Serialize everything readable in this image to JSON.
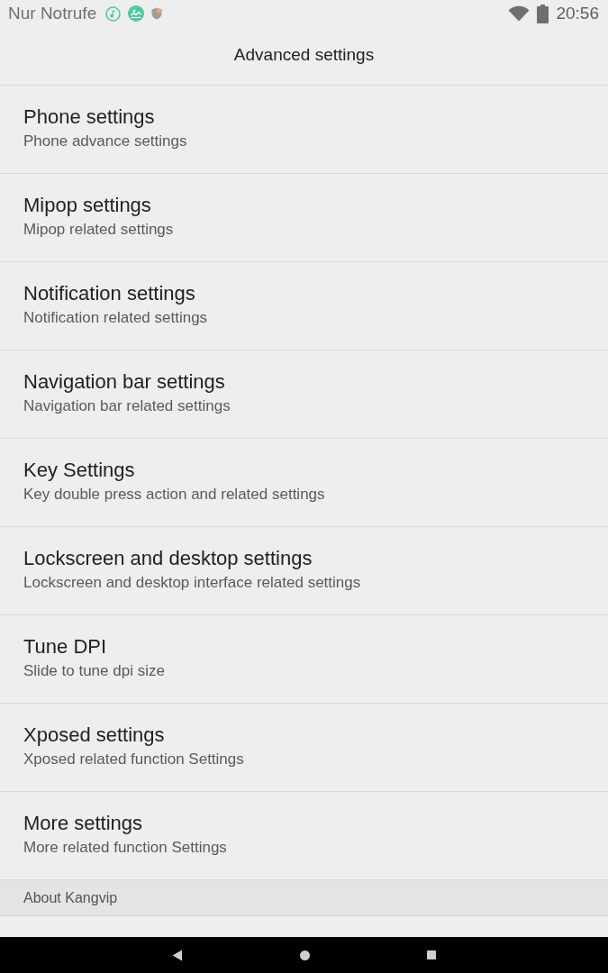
{
  "status_bar": {
    "carrier": "Nur Notrufe",
    "time": "20:56"
  },
  "toolbar": {
    "title": "Advanced settings"
  },
  "items": [
    {
      "title": "Phone settings",
      "summary": "Phone advance settings"
    },
    {
      "title": "Mipop settings",
      "summary": "Mipop related settings"
    },
    {
      "title": "Notification settings",
      "summary": "Notification related settings"
    },
    {
      "title": "Navigation bar settings",
      "summary": "Navigation bar related settings"
    },
    {
      "title": "Key Settings",
      "summary": "Key double press action and related settings"
    },
    {
      "title": "Lockscreen and desktop settings",
      "summary": "Lockscreen and desktop interface related settings"
    },
    {
      "title": "Tune DPI",
      "summary": "Slide to tune dpi size"
    },
    {
      "title": "Xposed settings",
      "summary": "Xposed related function Settings"
    },
    {
      "title": "More settings",
      "summary": "More related function Settings"
    }
  ],
  "category": {
    "title": "About Kangvip"
  }
}
